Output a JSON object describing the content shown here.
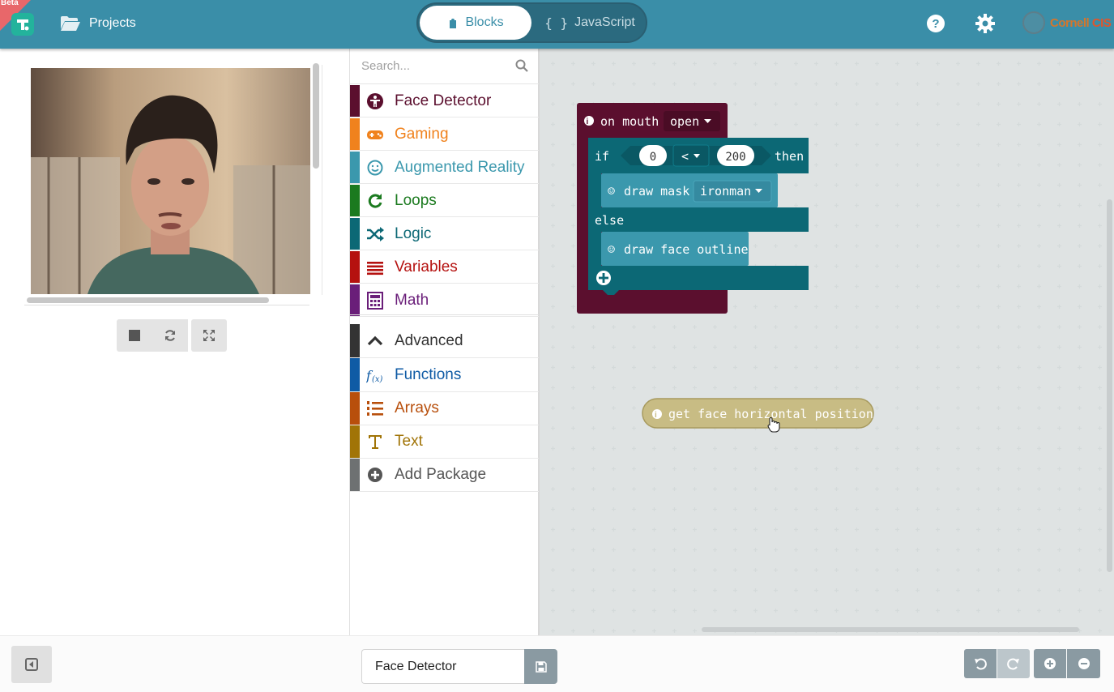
{
  "header": {
    "beta_label": "Beta",
    "projects_label": "Projects",
    "blocks_label": "Blocks",
    "javascript_label": "JavaScript",
    "org_name_a": "Cornell ",
    "org_name_b": "CIS"
  },
  "toolbox": {
    "search_placeholder": "Search...",
    "categories": [
      {
        "label": "Face Detector",
        "color": "#5b0f2e",
        "icon": "face-detector-icon"
      },
      {
        "label": "Gaming",
        "color": "#f0821d",
        "icon": "gamepad-icon"
      },
      {
        "label": "Augmented Reality",
        "color": "#3b98ad",
        "icon": "smiley-icon"
      },
      {
        "label": "Loops",
        "color": "#1b7a1f",
        "icon": "loop-icon"
      },
      {
        "label": "Logic",
        "color": "#0c6875",
        "icon": "shuffle-icon"
      },
      {
        "label": "Variables",
        "color": "#b5110f",
        "icon": "list-lines-icon"
      },
      {
        "label": "Math",
        "color": "#6a1e79",
        "icon": "calculator-icon"
      },
      {
        "label": "Advanced",
        "color": "#333333",
        "icon": "chevron-up-icon"
      },
      {
        "label": "Functions",
        "color": "#0f5ba5",
        "icon": "function-icon"
      },
      {
        "label": "Arrays",
        "color": "#b84f0c",
        "icon": "numbered-list-icon"
      },
      {
        "label": "Text",
        "color": "#a17407",
        "icon": "text-icon"
      },
      {
        "label": "Add Package",
        "color": "#6e7172",
        "icon": "plus-circle-icon"
      }
    ]
  },
  "workspace": {
    "event_block": {
      "label": "on mouth",
      "dropdown": "open",
      "color": "#5b0f2e"
    },
    "if_block": {
      "if_label": "if",
      "left_value": "0",
      "operator": "<",
      "right_value": "200",
      "then_label": "then",
      "else_label": "else",
      "color": "#0c6875"
    },
    "draw_mask": {
      "label": "draw mask",
      "dropdown": "ironman",
      "color": "#3b98ad"
    },
    "draw_outline": {
      "label": "draw face outline",
      "color": "#3b98ad"
    },
    "dragging_block": {
      "label": "get face horizontal position",
      "color": "#c8bc84"
    }
  },
  "footer": {
    "project_name": "Face Detector"
  },
  "colors": {
    "header_bg": "#3a8ea8",
    "workspace_bg": "#edf1f1"
  }
}
